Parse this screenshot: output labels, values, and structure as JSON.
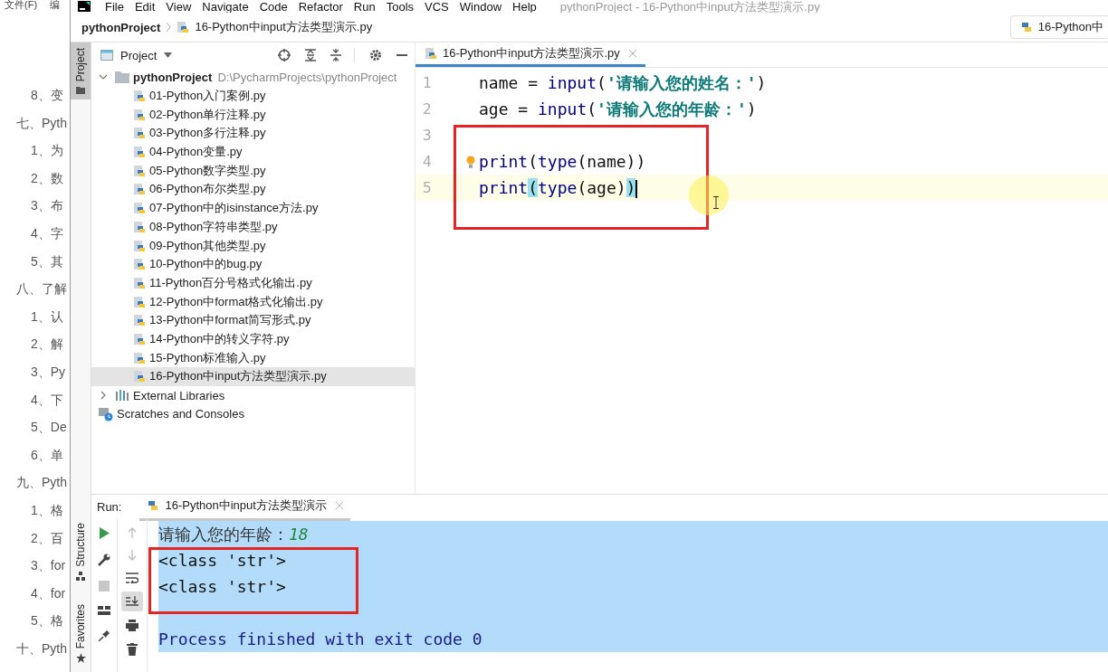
{
  "doc_outline": {
    "menu": [
      "文件(F)",
      "编"
    ],
    "items": [
      "8、变",
      "七、Pyth",
      "1、为",
      "2、数",
      "3、布",
      "4、字",
      "5、其",
      "八、了解",
      "1、认",
      "2、解",
      "3、Py",
      "4、下",
      "5、De",
      "6、单",
      "九、Pyth",
      "1、格",
      "2、百",
      "3、for",
      "4、for",
      "5、格",
      "十、Pyth"
    ]
  },
  "menu_bar": {
    "items": [
      "File",
      "Edit",
      "View",
      "Navigate",
      "Code",
      "Refactor",
      "Run",
      "Tools",
      "VCS",
      "Window",
      "Help"
    ],
    "title": "pythonProject - 16-Python中input方法类型演示.py"
  },
  "nav_bar": {
    "project": "pythonProject",
    "file": "16-Python中input方法类型演示.py",
    "run_config": "16-Python中"
  },
  "tool_strip": {
    "top": [
      {
        "label": "Project",
        "selected": true
      }
    ],
    "bottom": [
      {
        "label": "Structure",
        "kind": "structure"
      },
      {
        "label": "Favorites",
        "kind": "favorites"
      }
    ]
  },
  "project_panel": {
    "title": "Project",
    "tree": [
      {
        "name": "pythonProject",
        "path": "D:\\PycharmProjects\\pythonProject",
        "kind": "folder",
        "expanded": true,
        "children": [
          {
            "name": "01-Python入门案例.py",
            "kind": "file",
            "selected": false
          },
          {
            "name": "02-Python单行注释.py",
            "kind": "file",
            "selected": false
          },
          {
            "name": "03-Python多行注释.py",
            "kind": "file",
            "selected": false
          },
          {
            "name": "04-Python变量.py",
            "kind": "file",
            "selected": false
          },
          {
            "name": "05-Python数字类型.py",
            "kind": "file",
            "selected": false
          },
          {
            "name": "06-Python布尔类型.py",
            "kind": "file",
            "selected": false
          },
          {
            "name": "07-Python中的isinstance方法.py",
            "kind": "file",
            "selected": false
          },
          {
            "name": "08-Python字符串类型.py",
            "kind": "file",
            "selected": false
          },
          {
            "name": "09-Python其他类型.py",
            "kind": "file",
            "selected": false
          },
          {
            "name": "10-Python中的bug.py",
            "kind": "file",
            "selected": false
          },
          {
            "name": "11-Python百分号格式化输出.py",
            "kind": "file",
            "selected": false
          },
          {
            "name": "12-Python中format格式化输出.py",
            "kind": "file",
            "selected": false
          },
          {
            "name": "13-Python中format简写形式.py",
            "kind": "file",
            "selected": false
          },
          {
            "name": "14-Python中的转义字符.py",
            "kind": "file",
            "selected": false
          },
          {
            "name": "15-Python标准输入.py",
            "kind": "file",
            "selected": false
          },
          {
            "name": "16-Python中input方法类型演示.py",
            "kind": "file",
            "selected": true
          }
        ]
      },
      {
        "name": "External Libraries",
        "kind": "libraries",
        "expanded": false
      },
      {
        "name": "Scratches and Consoles",
        "kind": "scratches"
      }
    ]
  },
  "editor": {
    "tabs": [
      {
        "label": "16-Python中input方法类型演示.py",
        "selected": true
      }
    ],
    "lines": [
      {
        "number": "1",
        "current": false,
        "tokens": [
          {
            "text": "name = ",
            "kind": "plain"
          },
          {
            "text": "input",
            "kind": "builtin"
          },
          {
            "text": "(",
            "kind": "plain"
          },
          {
            "text": "'请输入您的姓名：'",
            "kind": "string"
          },
          {
            "text": ")",
            "kind": "plain"
          }
        ]
      },
      {
        "number": "2",
        "current": false,
        "tokens": [
          {
            "text": "age = ",
            "kind": "plain"
          },
          {
            "text": "input",
            "kind": "builtin"
          },
          {
            "text": "(",
            "kind": "plain"
          },
          {
            "text": "'请输入您的年龄：'",
            "kind": "string"
          },
          {
            "text": ")",
            "kind": "plain"
          }
        ]
      },
      {
        "number": "3",
        "current": false
      },
      {
        "number": "4",
        "current": false,
        "bulb": true,
        "tokens": [
          {
            "text": "print",
            "kind": "builtin"
          },
          {
            "text": "(",
            "kind": "plain"
          },
          {
            "text": "type",
            "kind": "builtin"
          },
          {
            "text": "(name))",
            "kind": "plain"
          }
        ]
      },
      {
        "number": "5",
        "current": true,
        "tokens": [
          {
            "text": "print",
            "kind": "builtin"
          },
          {
            "text": "(",
            "kind": "match"
          },
          {
            "text": "type",
            "kind": "builtin"
          },
          {
            "text": "(age)",
            "kind": "plain"
          },
          {
            "text": ")",
            "kind": "match"
          }
        ]
      }
    ]
  },
  "run_panel": {
    "label": "Run:",
    "tabs": [
      {
        "label": "16-Python中input方法类型演示",
        "selected": true
      }
    ],
    "console": {
      "selected": true,
      "lines": [
        {
          "kind": "prompt",
          "text": "请输入您的年龄：",
          "input": "18"
        },
        {
          "kind": "output",
          "text": "<class 'str'>"
        },
        {
          "kind": "output",
          "text": "<class 'str'>"
        },
        {
          "kind": "blank"
        },
        {
          "kind": "exit",
          "text": "Process finished with exit code 0"
        }
      ]
    }
  }
}
